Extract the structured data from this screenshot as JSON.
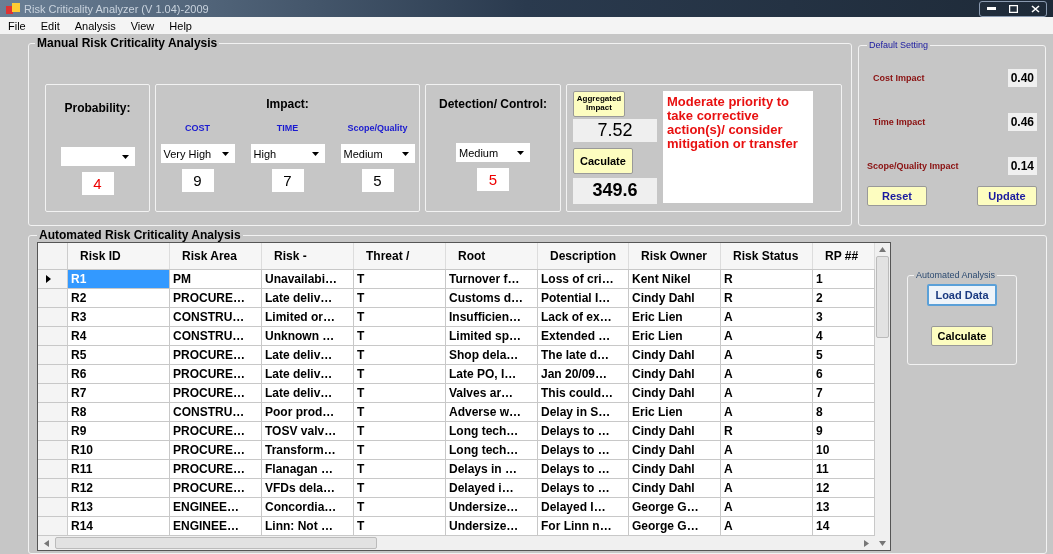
{
  "window": {
    "title": "Risk Criticality Analyzer (V 1.04)-2009"
  },
  "menu": [
    "File",
    "Edit",
    "Analysis",
    "View",
    "Help"
  ],
  "manual": {
    "title": "Manual Risk Criticality Analysis",
    "probability": {
      "label": "Probability:",
      "score": "4"
    },
    "impact": {
      "label": "Impact:",
      "columns": [
        {
          "label": "COST",
          "value": "Very High",
          "score": "9"
        },
        {
          "label": "TIME",
          "value": "High",
          "score": "7"
        },
        {
          "label": "Scope/Quality",
          "value": "Medium",
          "score": "5"
        }
      ]
    },
    "detection": {
      "label": "Detection/ Control:",
      "value": "Medium",
      "score": "5"
    },
    "result": {
      "aggregated_button": "Aggregated Impact",
      "aggregated_value": "7.52",
      "calculate_button": "Caculate",
      "total": "349.6",
      "message": "Moderate priority to take corrective action(s)/ consider mitigation or transfer"
    }
  },
  "default_setting": {
    "title": "Default Setting",
    "items": [
      {
        "label": "Cost Impact",
        "value": "0.40"
      },
      {
        "label": "Time Impact",
        "value": "0.46"
      },
      {
        "label": "Scope/Quality Impact",
        "value": "0.14"
      }
    ],
    "buttons": [
      "Reset",
      "Update"
    ]
  },
  "automated": {
    "title": "Automated Risk Criticality Analysis",
    "table": {
      "columns": [
        "Risk ID",
        "Risk Area",
        "Risk -",
        "Threat /",
        "Root",
        "Description",
        "Risk Owner",
        "Risk Status",
        "RP ##"
      ],
      "rows": [
        {
          "selected": true,
          "cells": [
            "R1",
            "PM",
            "Unavailabi…",
            "T",
            "Turnover f…",
            "Loss of cri…",
            "Kent Nikel",
            "R",
            "1"
          ]
        },
        {
          "selected": false,
          "cells": [
            "R2",
            "PROCURE…",
            "Late deliv…",
            "T",
            "Customs d…",
            "Potential I…",
            "Cindy Dahl",
            "R",
            "2"
          ]
        },
        {
          "selected": false,
          "cells": [
            "R3",
            "CONSTRU…",
            "Limited or…",
            "T",
            "Insufficien…",
            "Lack of ex…",
            "Eric Lien",
            "A",
            "3"
          ]
        },
        {
          "selected": false,
          "cells": [
            "R4",
            "CONSTRU…",
            "Unknown …",
            "T",
            "Limited sp…",
            "Extended …",
            "Eric Lien",
            "A",
            "4"
          ]
        },
        {
          "selected": false,
          "cells": [
            "R5",
            "PROCURE…",
            "Late deliv…",
            "T",
            "Shop dela…",
            "The late d…",
            "Cindy Dahl",
            "A",
            "5"
          ]
        },
        {
          "selected": false,
          "cells": [
            "R6",
            "PROCURE…",
            "Late deliv…",
            "T",
            "Late PO, I…",
            "Jan 20/09…",
            "Cindy Dahl",
            "A",
            "6"
          ]
        },
        {
          "selected": false,
          "cells": [
            "R7",
            "PROCURE…",
            "Late deliv…",
            "T",
            "Valves ar…",
            "This could…",
            "Cindy Dahl",
            "A",
            "7"
          ]
        },
        {
          "selected": false,
          "cells": [
            "R8",
            "CONSTRU…",
            "Poor prod…",
            "T",
            "Adverse w…",
            "Delay in S…",
            "Eric Lien",
            "A",
            "8"
          ]
        },
        {
          "selected": false,
          "cells": [
            "R9",
            "PROCURE…",
            "TOSV valv…",
            "T",
            "Long tech…",
            "Delays to …",
            "Cindy Dahl",
            "R",
            "9"
          ]
        },
        {
          "selected": false,
          "cells": [
            "R10",
            "PROCURE…",
            "Transform…",
            "T",
            "Long tech…",
            "Delays to …",
            "Cindy Dahl",
            "A",
            "10"
          ]
        },
        {
          "selected": false,
          "cells": [
            "R11",
            "PROCURE…",
            "Flanagan …",
            "T",
            "Delays in …",
            "Delays to …",
            "Cindy Dahl",
            "A",
            "11"
          ]
        },
        {
          "selected": false,
          "cells": [
            "R12",
            "PROCURE…",
            "VFDs dela…",
            "T",
            "Delayed i…",
            "Delays to …",
            "Cindy Dahl",
            "A",
            "12"
          ]
        },
        {
          "selected": false,
          "cells": [
            "R13",
            "ENGINEE…",
            "Concordia…",
            "T",
            "Undersize…",
            "Delayed I…",
            "George G…",
            "A",
            "13"
          ]
        },
        {
          "selected": false,
          "cells": [
            "R14",
            "ENGINEE…",
            "Linn: Not …",
            "T",
            "Undersize…",
            "For Linn n…",
            "George G…",
            "A",
            "14"
          ]
        }
      ]
    },
    "panel": {
      "title": "Automated Analysis",
      "buttons": [
        "Load Data",
        "Calculate"
      ]
    }
  }
}
